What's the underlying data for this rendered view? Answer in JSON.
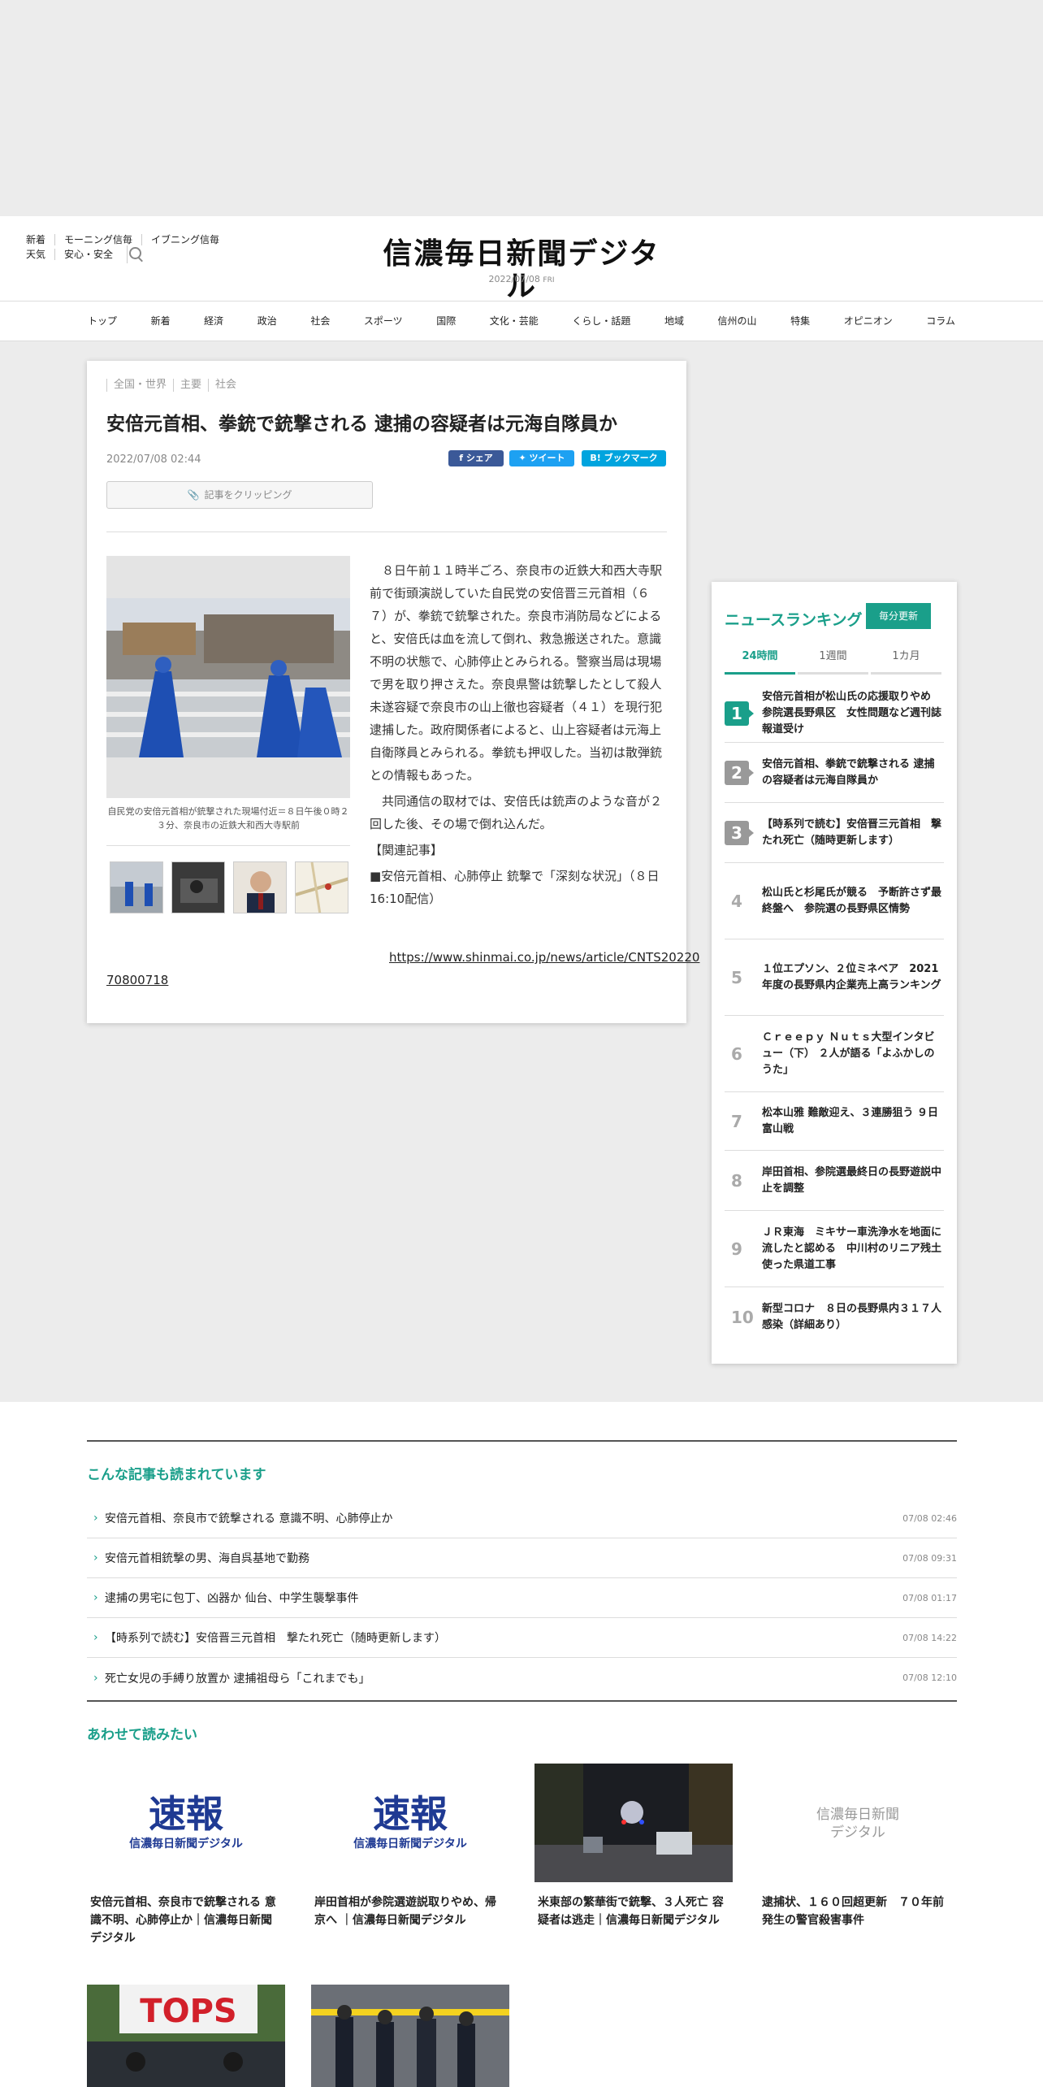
{
  "header": {
    "links_row1": [
      "新着",
      "モーニング信毎",
      "イブニング信毎"
    ],
    "links_row2": [
      "天気",
      "安心・安全"
    ],
    "logo": "信濃毎日新聞デジタル",
    "date": "2022/07/08",
    "weekday": "FRI"
  },
  "nav": [
    "トップ",
    "新着",
    "経済",
    "政治",
    "社会",
    "スポーツ",
    "国際",
    "文化・芸能",
    "くらし・話題",
    "地域",
    "信州の山",
    "特集",
    "オピニオン",
    "コラム"
  ],
  "article": {
    "categories": [
      "全国・世界",
      "主要",
      "社会"
    ],
    "title": "安倍元首相、拳銃で銃撃される 逮捕の容疑者は元海自隊員か",
    "date": "2022/07/08 02:44",
    "share_facebook": "シェア",
    "share_twitter": "ツイート",
    "share_hatena": "ブックマーク",
    "clip_label": "記事をクリッピング",
    "photo_caption": "自民党の安倍元首相が銃撃された現場付近＝８日午後０時２３分、奈良市の近鉄大和西大寺駅前",
    "body": [
      "８日午前１１時半ごろ、奈良市の近鉄大和西大寺駅前で街頭演説していた自民党の安倍晋三元首相（６７）が、拳銃で銃撃された。奈良市消防局などによると、安倍氏は血を流して倒れ、救急搬送された。意識不明の状態で、心肺停止とみられる。警察当局は現場で男を取り押さえた。奈良県警は銃撃したとして殺人未遂容疑で奈良市の山上徹也容疑者（４１）を現行犯逮捕した。政府関係者によると、山上容疑者は元海上自衛隊員とみられる。拳銃も押収した。当初は散弾銃との情報もあった。",
      "共同通信の取材では、安倍氏は銃声のような音が２回した後、その場で倒れ込んだ。"
    ],
    "related_label": "【関連記事】",
    "related_link": "■安倍元首相、心肺停止 銃撃で「深刻な状況」（８日16:10配信）",
    "url_part1": "https://www.shinmai.co.jp/news/article/CNTS20220",
    "url_part2": "70800718"
  },
  "ranking": {
    "title": "ニュースランキング",
    "update_label": "毎分更新",
    "tabs": [
      "24時間",
      "1週間",
      "1カ月"
    ],
    "active_tab": "24時間",
    "items": [
      {
        "rank": "1",
        "title": "安倍元首相が松山氏の応援取りやめ　参院選長野県区　女性問題など週刊誌報道受け"
      },
      {
        "rank": "2",
        "title": "安倍元首相、拳銃で銃撃される 逮捕の容疑者は元海自隊員か"
      },
      {
        "rank": "3",
        "title": "【時系列で読む】安倍晋三元首相　撃たれ死亡（随時更新します）"
      },
      {
        "rank": "4",
        "title": "松山氏と杉尾氏が競る　予断許さず最終盤へ　参院選の長野県区情勢"
      },
      {
        "rank": "5",
        "title": "１位エプソン、２位ミネベア　2021年度の長野県内企業売上高ランキング"
      },
      {
        "rank": "6",
        "title": "Ｃｒｅｅｐｙ Ｎｕｔｓ大型インタビュー（下） ２人が語る「よふかしのうた」"
      },
      {
        "rank": "7",
        "title": "松本山雅 難敵迎え、３連勝狙う ９日富山戦"
      },
      {
        "rank": "8",
        "title": "岸田首相、参院選最終日の長野遊説中止を調整"
      },
      {
        "rank": "9",
        "title": "ＪＲ東海　ミキサー車洗浄水を地面に流したと認める　中川村のリニア残土使った県道工事"
      },
      {
        "rank": "10",
        "title": "新型コロナ　８日の長野県内３１７人感染（詳細あり）"
      }
    ]
  },
  "also_read": {
    "title": "こんな記事も読まれています",
    "items": [
      {
        "title": "安倍元首相、奈良市で銃撃される 意識不明、心肺停止か",
        "date": "07/08 02:46"
      },
      {
        "title": "安倍元首相銃撃の男、海自呉基地で勤務",
        "date": "07/08 09:31"
      },
      {
        "title": "逮捕の男宅に包丁、凶器か 仙台、中学生襲撃事件",
        "date": "07/08 01:17"
      },
      {
        "title": "【時系列で読む】安倍晋三元首相　撃たれ死亡（随時更新します）",
        "date": "07/08 14:22"
      },
      {
        "title": "死亡女児の手縛り放置か 逮捕祖母ら「これまでも」",
        "date": "07/08 12:10"
      }
    ]
  },
  "recommend": {
    "title": "あわせて読みたい",
    "sokuho_big": "速報",
    "sokuho_small": "信濃毎日新聞デジタル",
    "placeholder_logo_line1": "信濃毎日新聞",
    "placeholder_logo_line2": "デジタル",
    "cards": [
      {
        "title": "安倍元首相、奈良市で銃撃される 意識不明、心肺停止か｜信濃毎日新聞デジタル"
      },
      {
        "title": "岸田首相が参院選遊説取りやめ、帰京へ ｜信濃毎日新聞デジタル"
      },
      {
        "title": "米東部の繁華街で銃撃、３人死亡 容疑者は逃走｜信濃毎日新聞デジタル"
      },
      {
        "title": "逮捕状、１６０回超更新　７０年前発生の警官殺害事件"
      }
    ],
    "tops_sign": "TOPS"
  }
}
